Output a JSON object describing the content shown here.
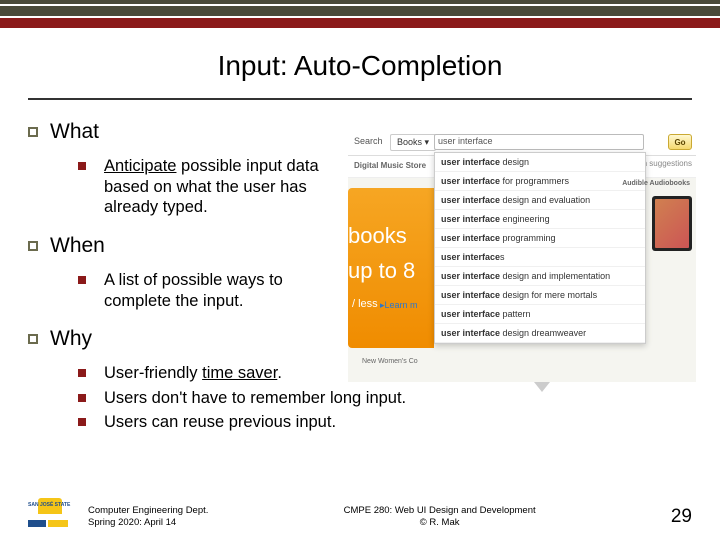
{
  "title": "Input: Auto-Completion",
  "sections": {
    "what": {
      "heading": "What",
      "bullet": {
        "lead": "Anticipate",
        "rest": " possible input data based on what the user has already typed."
      }
    },
    "when": {
      "heading": "When",
      "bullet": "A list of possible ways to complete the input."
    },
    "why": {
      "heading": "Why",
      "bullets": [
        {
          "lead": "User-friendly ",
          "underlined": "time saver",
          "tail": "."
        },
        {
          "text": "Users don't have to remember long input."
        },
        {
          "text": "Users can reuse previous input."
        }
      ]
    }
  },
  "screenshot": {
    "search_label": "Search",
    "books_tab": "Books ▾",
    "input_value": "user interface",
    "go_label": "Go",
    "dept_label": "Digital Music Store",
    "search_suggestions_label": "Search suggestions",
    "audiobooks_label": "Audible Audiobooks",
    "promo_books": "books",
    "promo_upto": "up to 8",
    "promo_less": "/ less",
    "promo_learn": "▸Learn m",
    "bottom_label": "New Women's Co",
    "dropdown": [
      {
        "prefix": "user interface",
        "suffix": " design"
      },
      {
        "prefix": "user interface",
        "suffix": " for programmers"
      },
      {
        "prefix": "user interface",
        "suffix": " design and evaluation"
      },
      {
        "prefix": "user interface",
        "suffix": " engineering"
      },
      {
        "prefix": "user interface",
        "suffix": " programming"
      },
      {
        "prefix": "user interface",
        "suffix": "s"
      },
      {
        "prefix": "user interface",
        "suffix": " design and implementation"
      },
      {
        "prefix": "user interface",
        "suffix": " design for mere mortals"
      },
      {
        "prefix": "user interface",
        "suffix": " pattern"
      },
      {
        "prefix": "user interface",
        "suffix": " design dreamweaver"
      }
    ]
  },
  "footer": {
    "logo_text": "SAN JOSÉ STATE",
    "dept_line1": "Computer Engineering Dept.",
    "dept_line2": "Spring 2020: April 14",
    "course_line1": "CMPE 280: Web UI Design and Development",
    "course_line2": "© R. Mak",
    "page_number": "29"
  }
}
